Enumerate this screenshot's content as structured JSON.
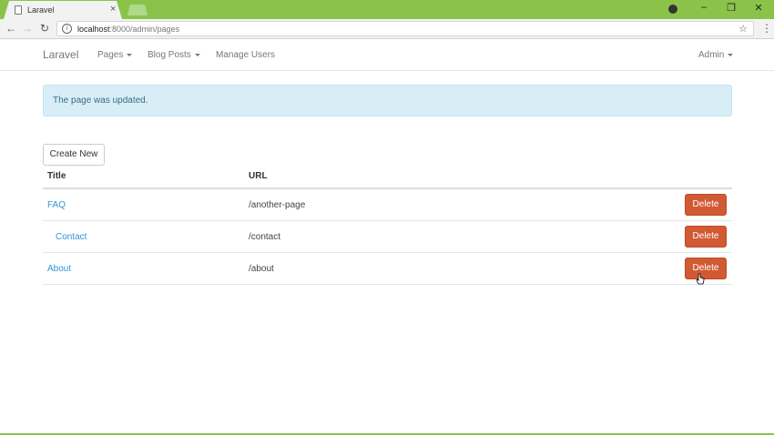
{
  "browser": {
    "tab_title": "Laravel",
    "url_host": "localhost",
    "url_path": ":8000/admin/pages",
    "accent": "#8bc34a"
  },
  "navbar": {
    "brand": "Laravel",
    "items": [
      {
        "label": "Pages",
        "dropdown": true
      },
      {
        "label": "Blog Posts",
        "dropdown": true
      },
      {
        "label": "Manage Users",
        "dropdown": false
      }
    ],
    "user_menu": "Admin"
  },
  "alert": {
    "message": "The page was updated."
  },
  "actions": {
    "create_label": "Create New"
  },
  "table": {
    "headers": [
      "Title",
      "URL"
    ],
    "rows": [
      {
        "title": "FAQ",
        "url": "/another-page",
        "action": "Delete"
      },
      {
        "title": "Contact",
        "url": "/contact",
        "action": "Delete"
      },
      {
        "title": "About",
        "url": "/about",
        "action": "Delete"
      }
    ]
  },
  "colors": {
    "link": "#3097d1",
    "delete_button": "#d05a33",
    "alert_bg": "#d9edf7"
  }
}
